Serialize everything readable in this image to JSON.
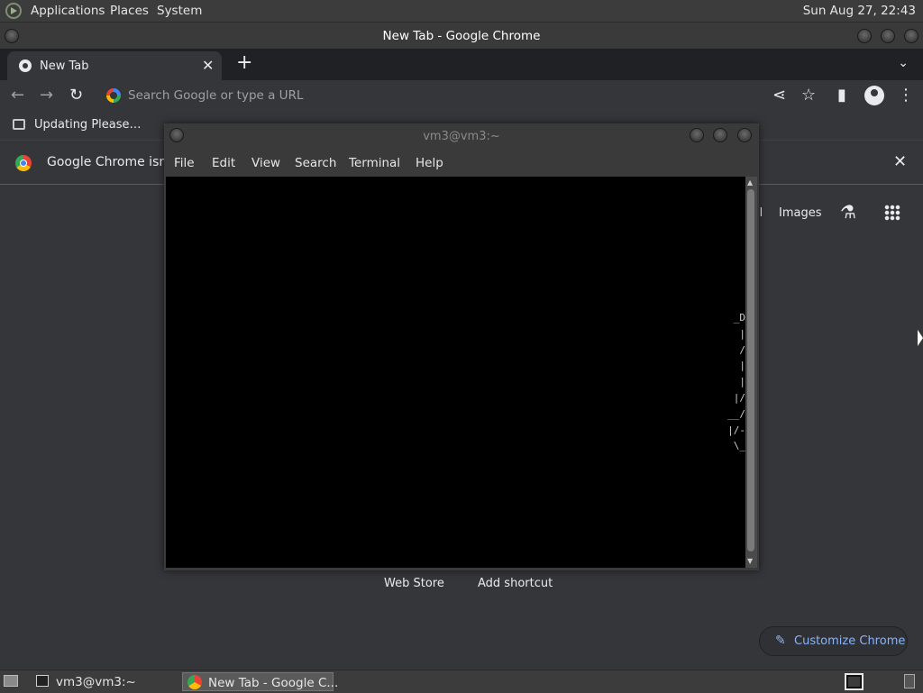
{
  "top_panel": {
    "menus": [
      "Applications",
      "Places",
      "System"
    ],
    "clock": "Sun Aug 27, 22:43"
  },
  "chrome": {
    "window_title": "New Tab - Google Chrome",
    "tab": {
      "title": "New Tab",
      "close": "✕"
    },
    "new_tab": "+",
    "tab_search": "⌄",
    "toolbar": {
      "back": "←",
      "forward": "→",
      "reload": "↻",
      "omnibox_placeholder": "Search Google or type a URL",
      "share": "⋖",
      "star": "☆",
      "side_panel": "▮",
      "menu": "⋮"
    },
    "bookmarks": [
      {
        "label": "Updating Please…"
      }
    ],
    "infobar": {
      "text": "Google Chrome isn't y",
      "close": "✕"
    },
    "ntp": {
      "gmail": "il",
      "images": "Images",
      "labs": "⚗",
      "web_store": "Web Store",
      "add_shortcut": "Add shortcut",
      "customize_icon": "✎",
      "customize_label": "Customize Chrome"
    }
  },
  "terminal": {
    "title": "vm3@vm3:~",
    "menus": [
      "File",
      "Edit",
      "View",
      "Search",
      "Terminal",
      "Help"
    ],
    "output": "_D\n|\n/\n|\n|\n|/\n__/\n|/-\n\\_",
    "scroll_up": "▲",
    "scroll_down": "▼"
  },
  "taskbar": {
    "tasks": [
      {
        "label": "vm3@vm3:~"
      },
      {
        "label": "New Tab - Google C..."
      }
    ]
  }
}
